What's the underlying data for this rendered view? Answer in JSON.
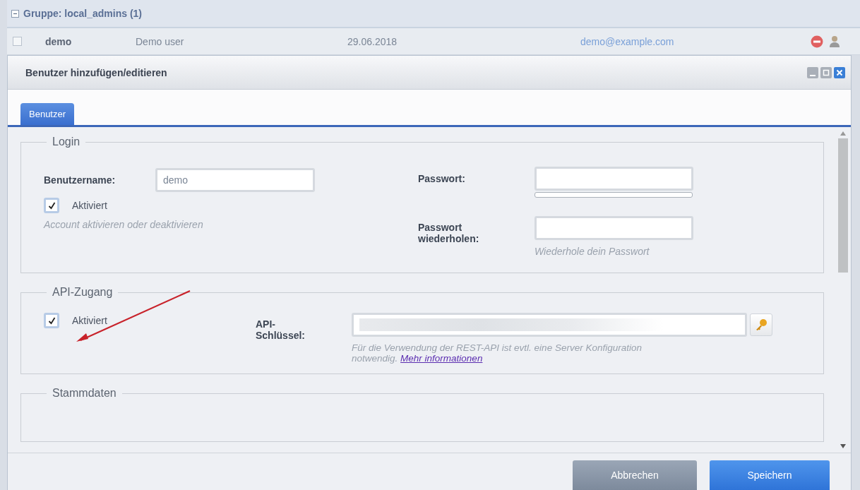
{
  "group": {
    "label": "Gruppe: local_admins (1)",
    "expanded": true
  },
  "user_row": {
    "selected": false,
    "username": "demo",
    "name": "Demo user",
    "date": "29.06.2018",
    "email": "demo@example.com"
  },
  "dialog": {
    "title": "Benutzer hinzufügen/editieren",
    "tabs": [
      {
        "label": "Benutzer",
        "selected": true
      }
    ],
    "login": {
      "legend": "Login",
      "username_label": "Benutzername:",
      "username_value": "demo",
      "active": {
        "label": "Aktiviert",
        "checked": true
      },
      "active_hint": "Account aktivieren oder deaktivieren",
      "password_label": "Passwort:",
      "repeat_label": "Passwort wiederholen:",
      "repeat_hint": "Wiederhole dein Passwort"
    },
    "api": {
      "legend": "API-Zugang",
      "active": {
        "label": "Aktiviert",
        "checked": true
      },
      "key_label": "API-Schlüssel:",
      "key_redacted": true,
      "hint": "Für die Verwendung der REST-API ist evtl. eine Server Konfiguration notwendig.",
      "link": "Mehr informationen"
    },
    "master": {
      "legend": "Stammdaten"
    },
    "buttons": [
      {
        "label": "Abbrechen",
        "kind": "secondary"
      },
      {
        "label": "Speichern",
        "kind": "primary"
      }
    ]
  }
}
